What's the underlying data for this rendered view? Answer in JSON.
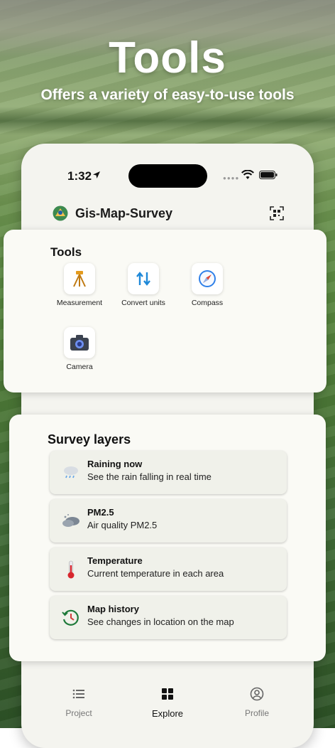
{
  "hero": {
    "title": "Tools",
    "subtitle": "Offers a variety of easy-to-use tools"
  },
  "status_bar": {
    "time": "1:32"
  },
  "app": {
    "title": "Gis-Map-Survey",
    "logo_icon": "map-pin-logo-icon",
    "qr_icon": "qr-scan-icon"
  },
  "tools": {
    "heading": "Tools",
    "items": [
      {
        "label": "Measurement",
        "icon": "surveyor-tripod-icon"
      },
      {
        "label": "Convert units",
        "icon": "convert-arrows-icon"
      },
      {
        "label": "Compass",
        "icon": "compass-icon"
      },
      {
        "label": "Camera",
        "icon": "camera-icon"
      }
    ]
  },
  "survey": {
    "heading": "Survey layers",
    "layers": [
      {
        "title": "Raining now",
        "desc": "See the rain falling in real time",
        "icon": "rain-cloud-icon"
      },
      {
        "title": "PM2.5",
        "desc": "Air quality PM2.5",
        "icon": "smog-icon"
      },
      {
        "title": "Temperature",
        "desc": "Current temperature in each area",
        "icon": "thermometer-icon"
      },
      {
        "title": "Map history",
        "desc": "See changes in location on the map",
        "icon": "history-clock-icon"
      }
    ]
  },
  "tabs": [
    {
      "label": "Project",
      "icon": "list-icon",
      "active": false
    },
    {
      "label": "Explore",
      "icon": "grid-icon",
      "active": true
    },
    {
      "label": "Profile",
      "icon": "profile-icon",
      "active": false
    }
  ],
  "colors": {
    "accent": "#2e8b57",
    "card": "#fafaf5",
    "phone_bg": "#f4f4ef"
  }
}
